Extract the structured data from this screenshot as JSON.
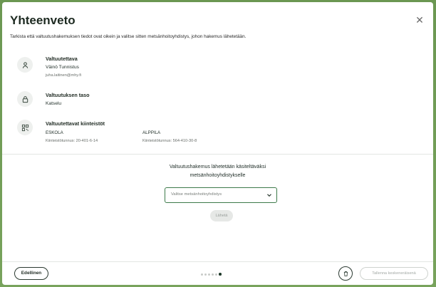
{
  "modal": {
    "title": "Yhteenveto",
    "close_icon": "close-icon",
    "intro": "Tarkista että valtuutushakemuksen tiedot ovat oikein ja valitse sitten metsänhoitoyhdistys, johon hakemus lähetetään."
  },
  "authorized": {
    "icon": "person-icon",
    "title": "Valtuutettava",
    "name": "Väinö Tunnistus",
    "email": "juha.laitinen@mhy.fi"
  },
  "level": {
    "icon": "lock-icon",
    "title": "Valtuutuksen taso",
    "value": "Katselu"
  },
  "properties": {
    "icon": "qr-code-icon",
    "title": "Valtuutettavat kiinteistöt",
    "items": [
      {
        "name": "ESKOLA",
        "id": "Kiinteistötunnus: 20-401-6-14"
      },
      {
        "name": "ALPPILA",
        "id": "Kiinteistötunnus: 564-410-30-8"
      }
    ]
  },
  "send": {
    "text_line1": "Valtuutushakemus lähetetään käsiteltäväksi",
    "text_line2": "metsänhoitoyhdistykselle",
    "select_placeholder": "Valitse metsänhoitoyhdistys",
    "send_label": "Lähetä"
  },
  "footer": {
    "prev_label": "Edellinen",
    "steps_total": 6,
    "current_step": 6,
    "save_label": "Tallenna keskeneräisenä",
    "trash_icon": "trash-icon"
  },
  "colors": {
    "accent": "#3d7a4a",
    "backdrop": "#6f9a52"
  }
}
